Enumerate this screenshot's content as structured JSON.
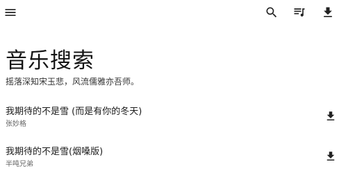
{
  "colors": {
    "background": "#ffffff",
    "icon": "#222222",
    "title_text": "#141414",
    "secondary_text": "#666666"
  },
  "toolbar": {
    "icons": [
      "menu-icon",
      "search-icon",
      "queue-music-icon",
      "download-icon"
    ]
  },
  "header": {
    "title": "音乐搜索",
    "subtitle": "摇落深知宋玉悲，风流儒雅亦吾师。"
  },
  "songs": [
    {
      "title": "我期待的不是雪 (而是有你的冬天)",
      "artist": "张妙格",
      "action_icon": "download-icon"
    },
    {
      "title": "我期待的不是雪(烟嗓版)",
      "artist": "半吨兄弟",
      "action_icon": "download-icon"
    }
  ]
}
